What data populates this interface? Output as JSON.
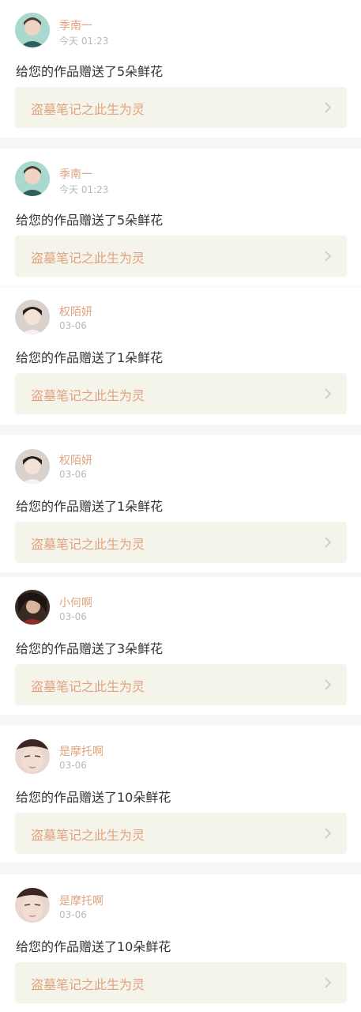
{
  "colors": {
    "page_bg": "#f6f6f6",
    "card_bg": "#ffffff",
    "username": "#e0a27e",
    "time": "#b9b9b9",
    "message": "#333333",
    "work_bg": "#f5f4eb",
    "work_title": "#e0a27e",
    "chevron": "#c8c8c8"
  },
  "notifications": [
    {
      "username": "季南一",
      "time": "今天 01:23",
      "message": "给您的作品赠送了5朵鲜花",
      "work_title": "盗墓笔记之此生为灵",
      "avatar": "avatar-young-man-teal"
    },
    {
      "username": "季南一",
      "time": "今天 01:23",
      "message": "给您的作品赠送了5朵鲜花",
      "work_title": "盗墓笔记之此生为灵",
      "avatar": "avatar-young-man-teal"
    },
    {
      "username": "权陌妍",
      "time": "03-06",
      "message": "给您的作品赠送了1朵鲜花",
      "work_title": "盗墓笔记之此生为灵",
      "avatar": "avatar-child-portrait"
    },
    {
      "username": "权陌妍",
      "time": "03-06",
      "message": "给您的作品赠送了1朵鲜花",
      "work_title": "盗墓笔记之此生为灵",
      "avatar": "avatar-child-portrait"
    },
    {
      "username": "小何啊",
      "time": "03-06",
      "message": "给您的作品赠送了3朵鲜花",
      "work_title": "盗墓笔记之此生为灵",
      "avatar": "avatar-dark-portrait"
    },
    {
      "username": "是摩托啊",
      "time": "03-06",
      "message": "给您的作品赠送了10朵鲜花",
      "work_title": "盗墓笔记之此生为灵",
      "avatar": "avatar-face-closeup"
    },
    {
      "username": "是摩托啊",
      "time": "03-06",
      "message": "给您的作品赠送了10朵鲜花",
      "work_title": "盗墓笔记之此生为灵",
      "avatar": "avatar-face-closeup"
    }
  ]
}
